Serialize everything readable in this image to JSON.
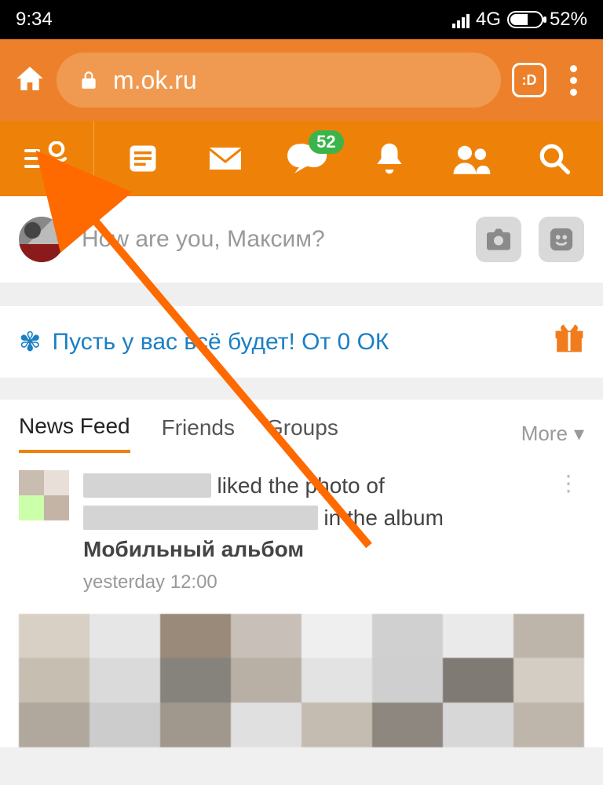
{
  "status": {
    "time": "9:34",
    "network": "4G",
    "battery": "52%"
  },
  "browser": {
    "url": "m.ok.ru",
    "tabs_label": ":D"
  },
  "appnav": {
    "badge_count": "52"
  },
  "compose": {
    "placeholder": "How are you, Максим?"
  },
  "promo": {
    "text": "Пусть у вас всё будет! От 0 ОК"
  },
  "tabs": {
    "items": [
      "News Feed",
      "Friends",
      "Groups"
    ],
    "more": "More"
  },
  "feed": {
    "text_liked": " liked the photo of ",
    "text_in": " in the album ",
    "album": "Мобильный альбом",
    "timestamp": "yesterday 12:00"
  }
}
